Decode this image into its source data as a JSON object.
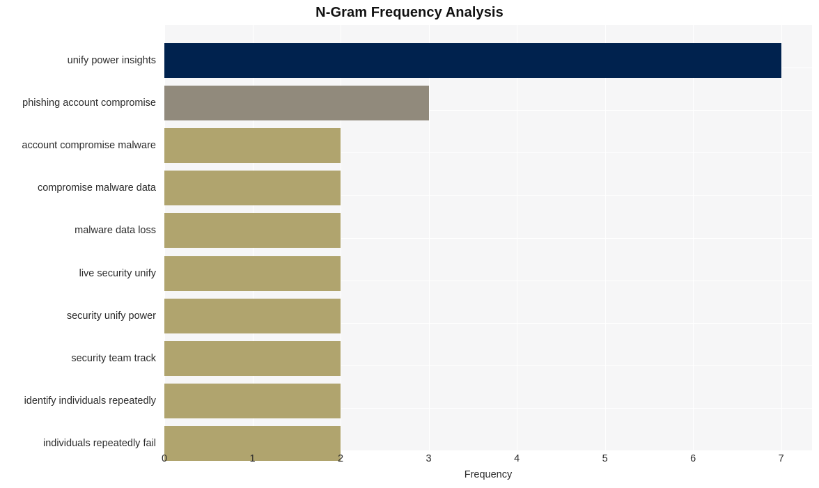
{
  "chart_data": {
    "type": "bar",
    "orientation": "horizontal",
    "title": "N-Gram Frequency Analysis",
    "xlabel": "Frequency",
    "ylabel": "",
    "xlim": [
      0,
      7.35
    ],
    "xticks": [
      0,
      1,
      2,
      3,
      4,
      5,
      6,
      7
    ],
    "xtick_labels": [
      "0",
      "1",
      "2",
      "3",
      "4",
      "5",
      "6",
      "7"
    ],
    "grid": true,
    "legend": "none",
    "categories": [
      "unify power insights",
      "phishing account compromise",
      "account compromise malware",
      "compromise malware data",
      "malware data loss",
      "live security unify",
      "security unify power",
      "security team track",
      "identify individuals repeatedly",
      "individuals repeatedly fail"
    ],
    "values": [
      7,
      3,
      2,
      2,
      2,
      2,
      2,
      2,
      2,
      2
    ],
    "bar_colors": [
      "#00224e",
      "#918a7c",
      "#b0a46e",
      "#b0a46e",
      "#b0a46e",
      "#b0a46e",
      "#b0a46e",
      "#b0a46e",
      "#b0a46e",
      "#b0a46e"
    ]
  },
  "style": {
    "plot_background": "#f6f6f7",
    "grid_color": "#ffffff",
    "figure_background": "#ffffff",
    "text_color": "#2b2b2b",
    "title_color": "#111111"
  }
}
